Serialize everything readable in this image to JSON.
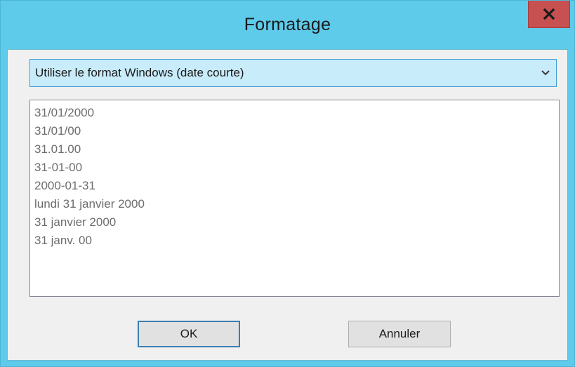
{
  "window": {
    "title": "Formatage"
  },
  "icons": {
    "close": "close-icon",
    "dropdown": "chevron-down-icon"
  },
  "format_select": {
    "selected": "Utiliser le format Windows (date courte)"
  },
  "preview_list": {
    "items": [
      "31/01/2000",
      "31/01/00",
      "31.01.00",
      "31-01-00",
      "2000-01-31",
      "lundi 31 janvier 2000",
      "31 janvier 2000",
      "31 janv. 00"
    ]
  },
  "buttons": {
    "ok_label": "OK",
    "cancel_label": "Annuler"
  },
  "colors": {
    "titlebar": "#5ecbeb",
    "close_button": "#c75050",
    "combo_background": "#c9ecfb",
    "combo_border": "#3d9bd1",
    "list_text": "#6d6d6d"
  }
}
